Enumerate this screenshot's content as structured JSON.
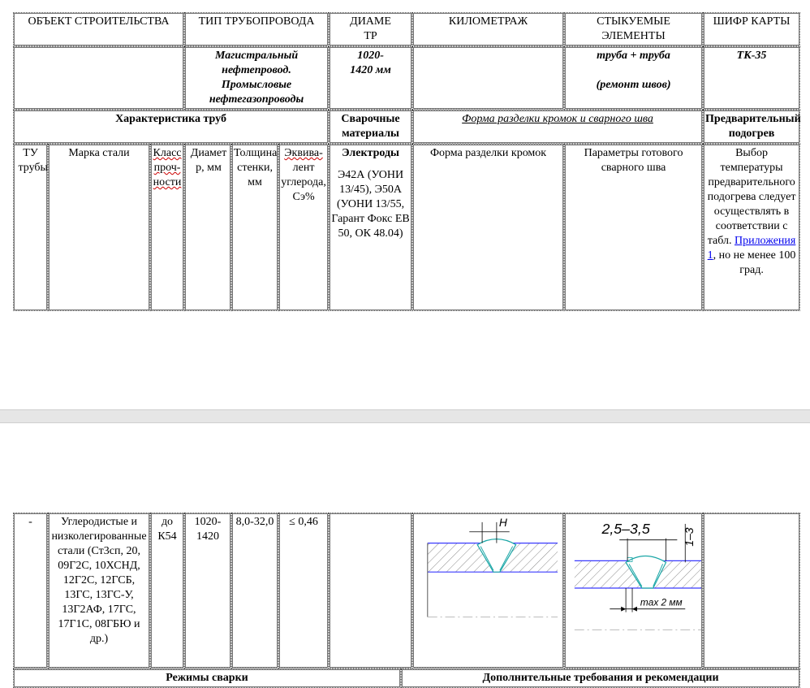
{
  "header": {
    "object": "ОБЪЕКТ СТРОИТЕЛЬСТВА",
    "pipe_type": "ТИП ТРУБОПРОВОДА",
    "diameter": "ДИАМЕ ТР",
    "km": "КИЛОМЕТРАЖ",
    "joined": "СТЫКУЕМЫЕ ЭЛЕМЕНТЫ",
    "card_code": "ШИФР КАРТЫ"
  },
  "values": {
    "pipe_type_l1": "Магистральный",
    "pipe_type_l2": "нефтепровод.",
    "pipe_type_l3": "Промысловые",
    "pipe_type_l4": "нефтегазопроводы",
    "diameter": "1020-1420 мм",
    "joined_l1": "труба + труба",
    "joined_l2": "(ремонт швов)",
    "card_code": "ТК-35"
  },
  "section": {
    "pipes": "Характеристика труб",
    "materials": "Сварочные материалы",
    "edge_form": "Форма разделки кромок и сварного шва",
    "preheat": "Предварительный подогрев"
  },
  "columns": {
    "tu": "ТУ трубы",
    "steel": "Марка стали",
    "class": "Класс проч-ности",
    "diam": "Диаметр, мм",
    "wall": "Толщина стенки, мм",
    "equiv_w": "Эквива-",
    "equiv_rest": "лент углерода, Сэ%",
    "electrodes": "Электроды",
    "electrodes_list": "Э42А (УОНИ 13/45), Э50А (УОНИ 13/55, Гарант Фокс ЕВ 50, ОК 48.04)",
    "edge_prep": "Форма разделки кромок",
    "weld_params": "Параметры готового сварного шва",
    "preheat_text1": "Выбор температуры предварительного подогрева следует осуществлять в соответствии с табл.",
    "preheat_link": "Приложения 1",
    "preheat_text2": ", но не менее 100 град."
  },
  "row": {
    "tu": "-",
    "steel": "Углеродистые и низколегированные стали (Ст3сп, 20, 09Г2С, 10ХСНД, 12Г2С, 12ГСБ, 13ГС, 13ГС-У, 13Г2АФ, 17ГС, 17Г1С, 08ГБЮ и др.)",
    "class": "до К54",
    "diam": "1020-1420",
    "wall": "8,0-32,0",
    "equiv_sym": "≤",
    "equiv": "0,46"
  },
  "drawing": {
    "left_label": "H",
    "right_top": "2,5–3,5",
    "right_side": "1–3",
    "right_bottom": "max 2 мм"
  },
  "footer": {
    "modes": "Режимы сварки",
    "extra": "Дополнительные требования и рекомендации"
  },
  "colors": {
    "line_blue": "#3a3aff",
    "weld_teal": "#1aa6a6",
    "hatch": "#8a8a8a"
  }
}
